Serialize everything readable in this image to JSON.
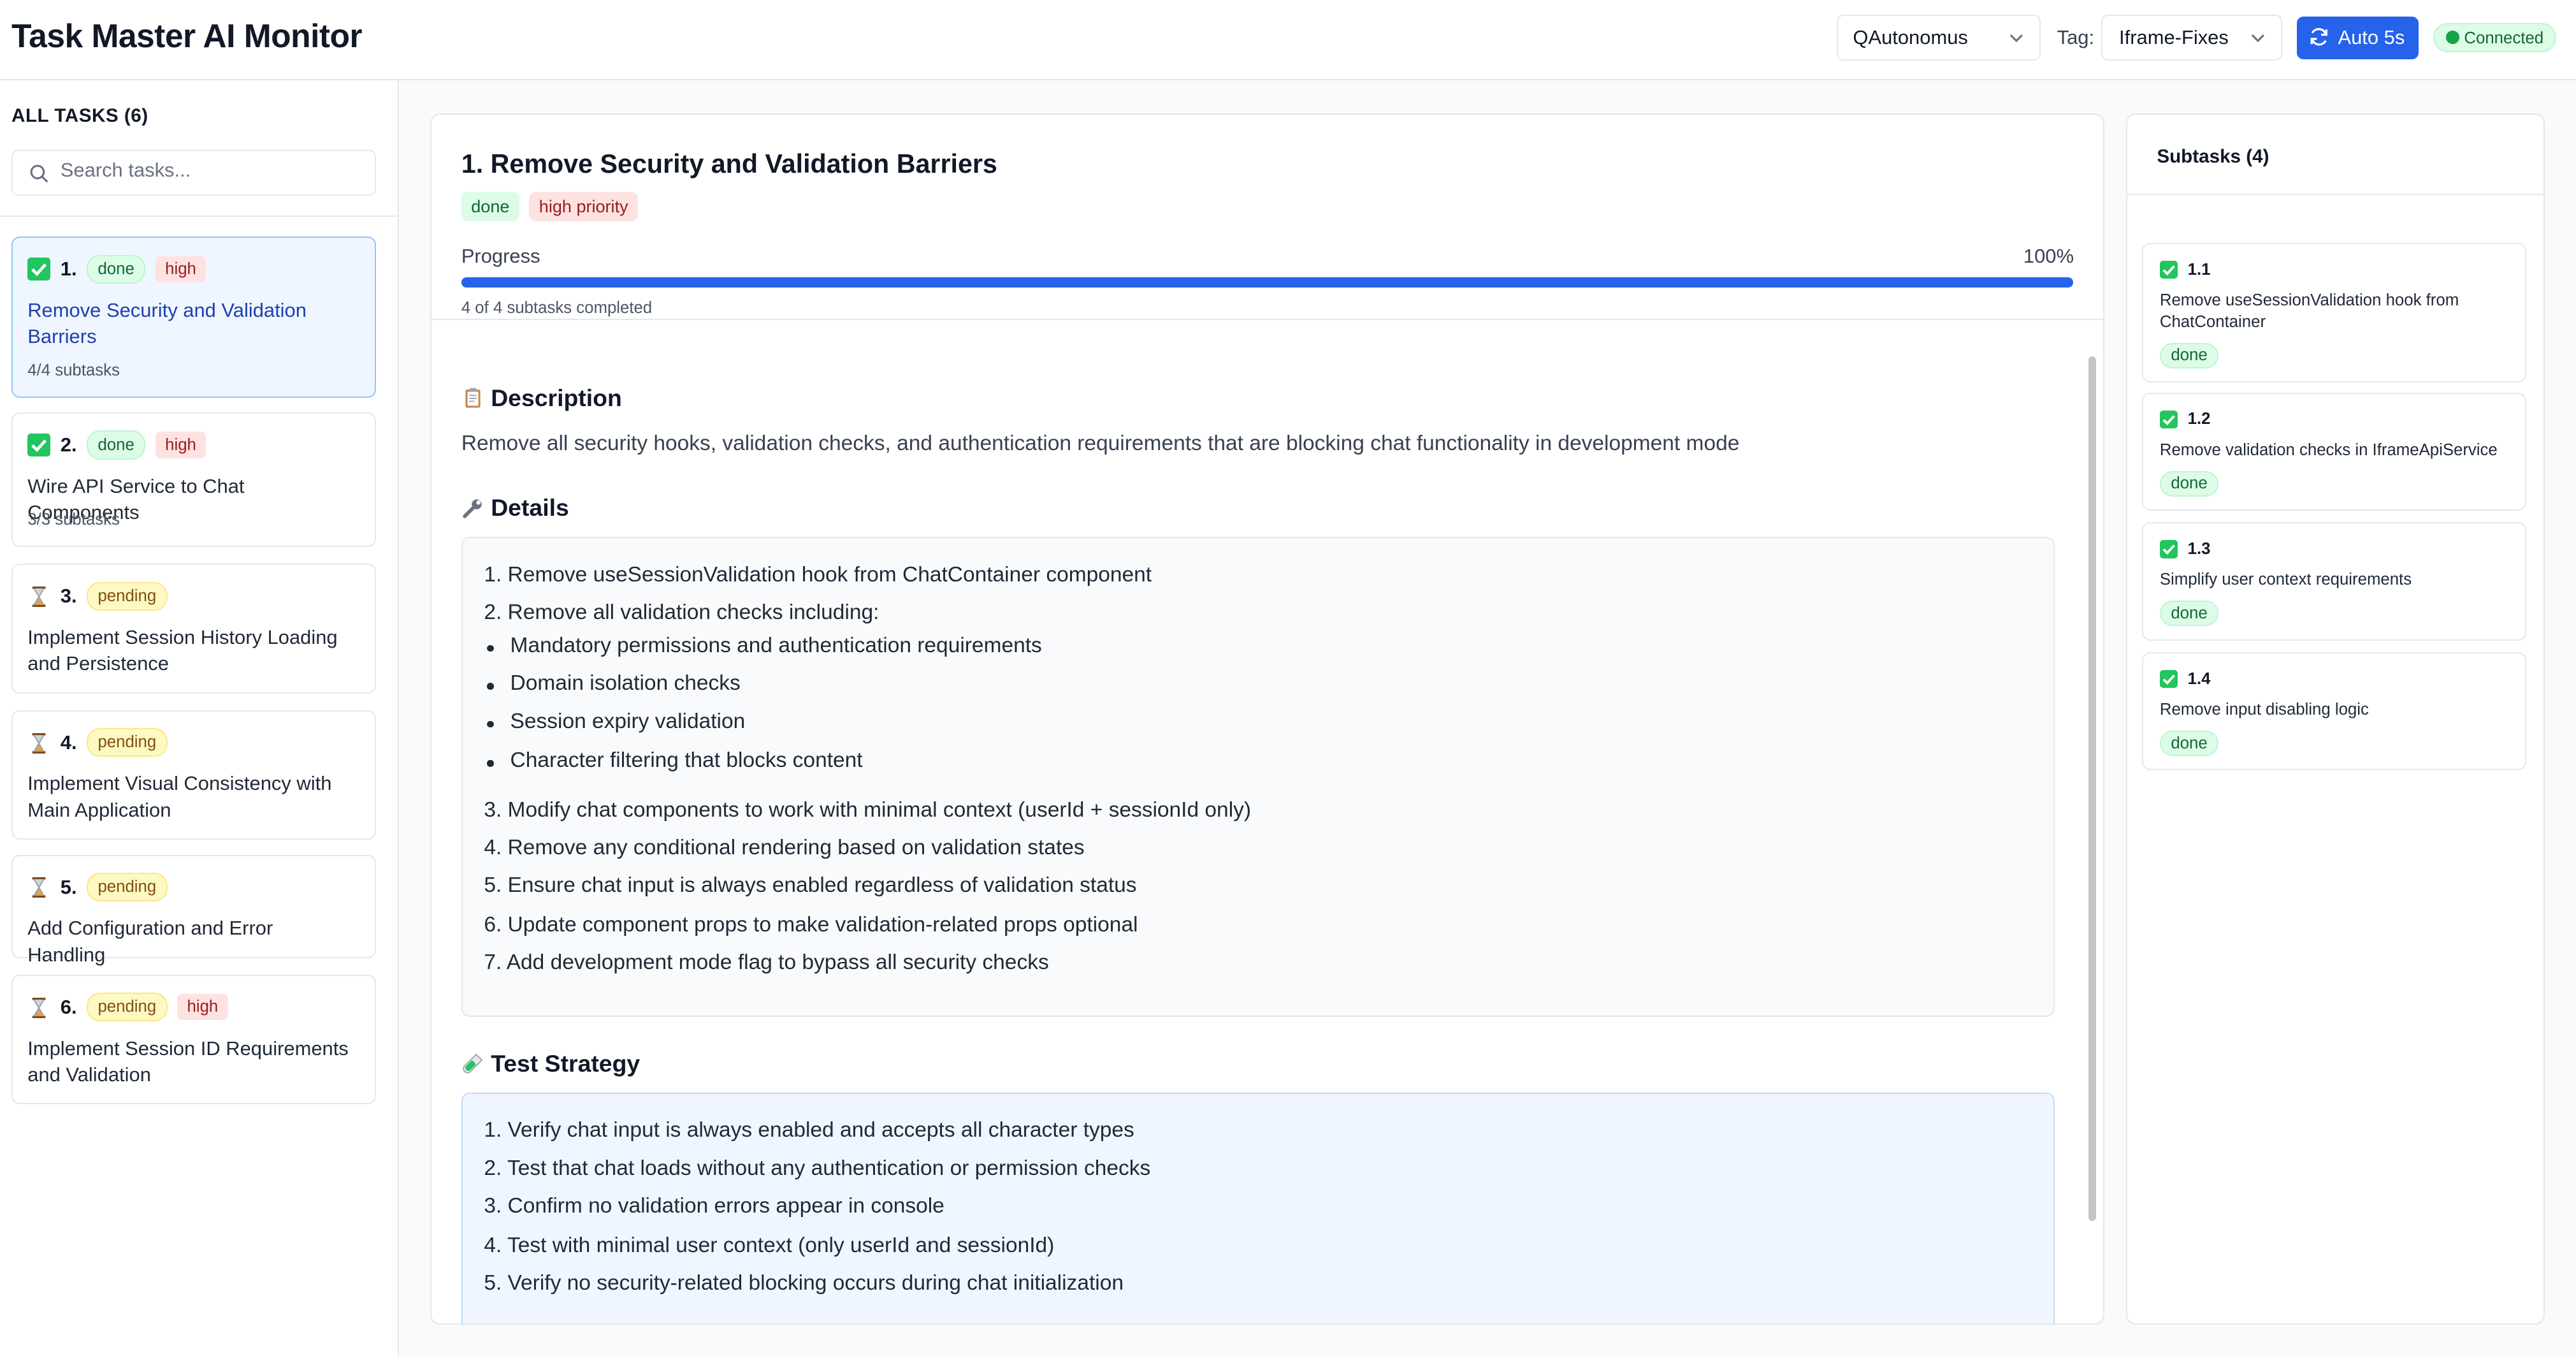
{
  "app": {
    "title": "Task Master AI Monitor",
    "project": "QAutonomus",
    "tag_label": "Tag:",
    "tag": "Iframe-Fixes",
    "auto_button": "Auto 5s",
    "connection": "Connected"
  },
  "colors": {
    "accent": "#2563eb",
    "done_bg": "#dcfce7",
    "done_text": "#166534",
    "pending_bg": "#fef9c3",
    "pending_text": "#854d0e",
    "high_bg": "#fee2e2",
    "high_text": "#991b1b"
  },
  "sidebar": {
    "heading": "ALL TASKS (6)",
    "search_placeholder": "Search tasks...",
    "tasks": [
      {
        "icon": "check-icon",
        "num": "1.",
        "status": "done",
        "priority": "high",
        "title": "Remove Security and Validation Barriers",
        "subtasks": "4/4 subtasks"
      },
      {
        "icon": "check-icon",
        "num": "2.",
        "status": "done",
        "priority": "high",
        "title": "Wire API Service to Chat Components",
        "subtasks": "3/3 subtasks"
      },
      {
        "icon": "hourglass-icon",
        "num": "3.",
        "status": "pending",
        "priority": "",
        "title": "Implement Session History Loading and Persistence",
        "subtasks": ""
      },
      {
        "icon": "hourglass-icon",
        "num": "4.",
        "status": "pending",
        "priority": "",
        "title": "Implement Visual Consistency with Main Application",
        "subtasks": ""
      },
      {
        "icon": "hourglass-icon",
        "num": "5.",
        "status": "pending",
        "priority": "",
        "title": "Add Configuration and Error Handling",
        "subtasks": ""
      },
      {
        "icon": "hourglass-icon",
        "num": "6.",
        "status": "pending",
        "priority": "high",
        "title": "Implement Session ID Requirements and Validation",
        "subtasks": ""
      }
    ]
  },
  "detail": {
    "title": "1. Remove Security and Validation Barriers",
    "status": "done",
    "priority": "high priority",
    "progress_label": "Progress",
    "progress_pct": "100%",
    "progress_value": 1.0,
    "progress_sub": "4 of 4 subtasks completed",
    "description_heading": "Description",
    "description_icon": "clipboard-icon",
    "description": "Remove all security hooks, validation checks, and authentication requirements that are blocking chat functionality in development mode",
    "details_heading": "Details",
    "details_icon": "wrench-icon",
    "details": {
      "step1": "1. Remove useSessionValidation hook from ChatContainer component",
      "step2": "2. Remove all validation checks including:",
      "bullets": [
        "Mandatory permissions and authentication requirements",
        "Domain isolation checks",
        "Session expiry validation",
        "Character filtering that blocks content"
      ],
      "rest": [
        "3. Modify chat components to work with minimal context (userId + sessionId only)",
        "4. Remove any conditional rendering based on validation states",
        "5. Ensure chat input is always enabled regardless of validation status",
        "6. Update component props to make validation-related props optional",
        "7. Add development mode flag to bypass all security checks"
      ]
    },
    "test_heading": "Test Strategy",
    "test_icon": "test-tube-icon",
    "test_steps": [
      "1. Verify chat input is always enabled and accepts all character types",
      "2. Test that chat loads without any authentication or permission checks",
      "3. Confirm no validation errors appear in console",
      "4. Test with minimal user context (only userId and sessionId)",
      "5. Verify no security-related blocking occurs during chat initialization"
    ]
  },
  "subtasks": {
    "title": "Subtasks (4)",
    "items": [
      {
        "id": "1.1",
        "title": "Remove useSessionValidation hook from ChatContainer",
        "status": "done"
      },
      {
        "id": "1.2",
        "title": "Remove validation checks in IframeApiService",
        "status": "done"
      },
      {
        "id": "1.3",
        "title": "Simplify user context requirements",
        "status": "done"
      },
      {
        "id": "1.4",
        "title": "Remove input disabling logic",
        "status": "done"
      }
    ]
  }
}
